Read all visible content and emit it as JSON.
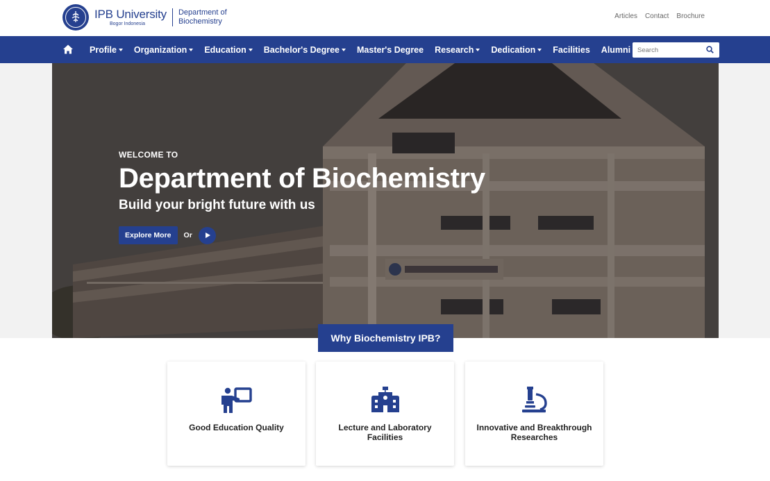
{
  "brand": {
    "university": "IPB University",
    "university_sub": "Bogor Indonesia",
    "department": "Department of Biochemistry",
    "color_primary": "#25408f"
  },
  "top_links": [
    "Articles",
    "Contact",
    "Brochure"
  ],
  "nav": {
    "home_icon": "home-icon",
    "items": [
      {
        "label": "Profile",
        "dropdown": true
      },
      {
        "label": "Organization",
        "dropdown": true
      },
      {
        "label": "Education",
        "dropdown": true
      },
      {
        "label": "Bachelor's Degree",
        "dropdown": true
      },
      {
        "label": "Master's Degree",
        "dropdown": false
      },
      {
        "label": "Research",
        "dropdown": true
      },
      {
        "label": "Dedication",
        "dropdown": true
      },
      {
        "label": "Facilities",
        "dropdown": false
      },
      {
        "label": "Alumni",
        "dropdown": false
      }
    ],
    "search": {
      "placeholder": "Search",
      "value": ""
    }
  },
  "hero": {
    "welcome": "WELCOME TO",
    "title": "Department of Biochemistry",
    "tagline": "Build your bright future with us",
    "explore_label": "Explore More",
    "or_label": "Or"
  },
  "why": {
    "title": "Why Biochemistry IPB?",
    "cards": [
      {
        "icon": "teacher-board-icon",
        "label": "Good Education Quality"
      },
      {
        "icon": "school-building-icon",
        "label": "Lecture and Laboratory Facilities"
      },
      {
        "icon": "microscope-icon",
        "label": "Innovative and Breakthrough Researches"
      }
    ]
  }
}
